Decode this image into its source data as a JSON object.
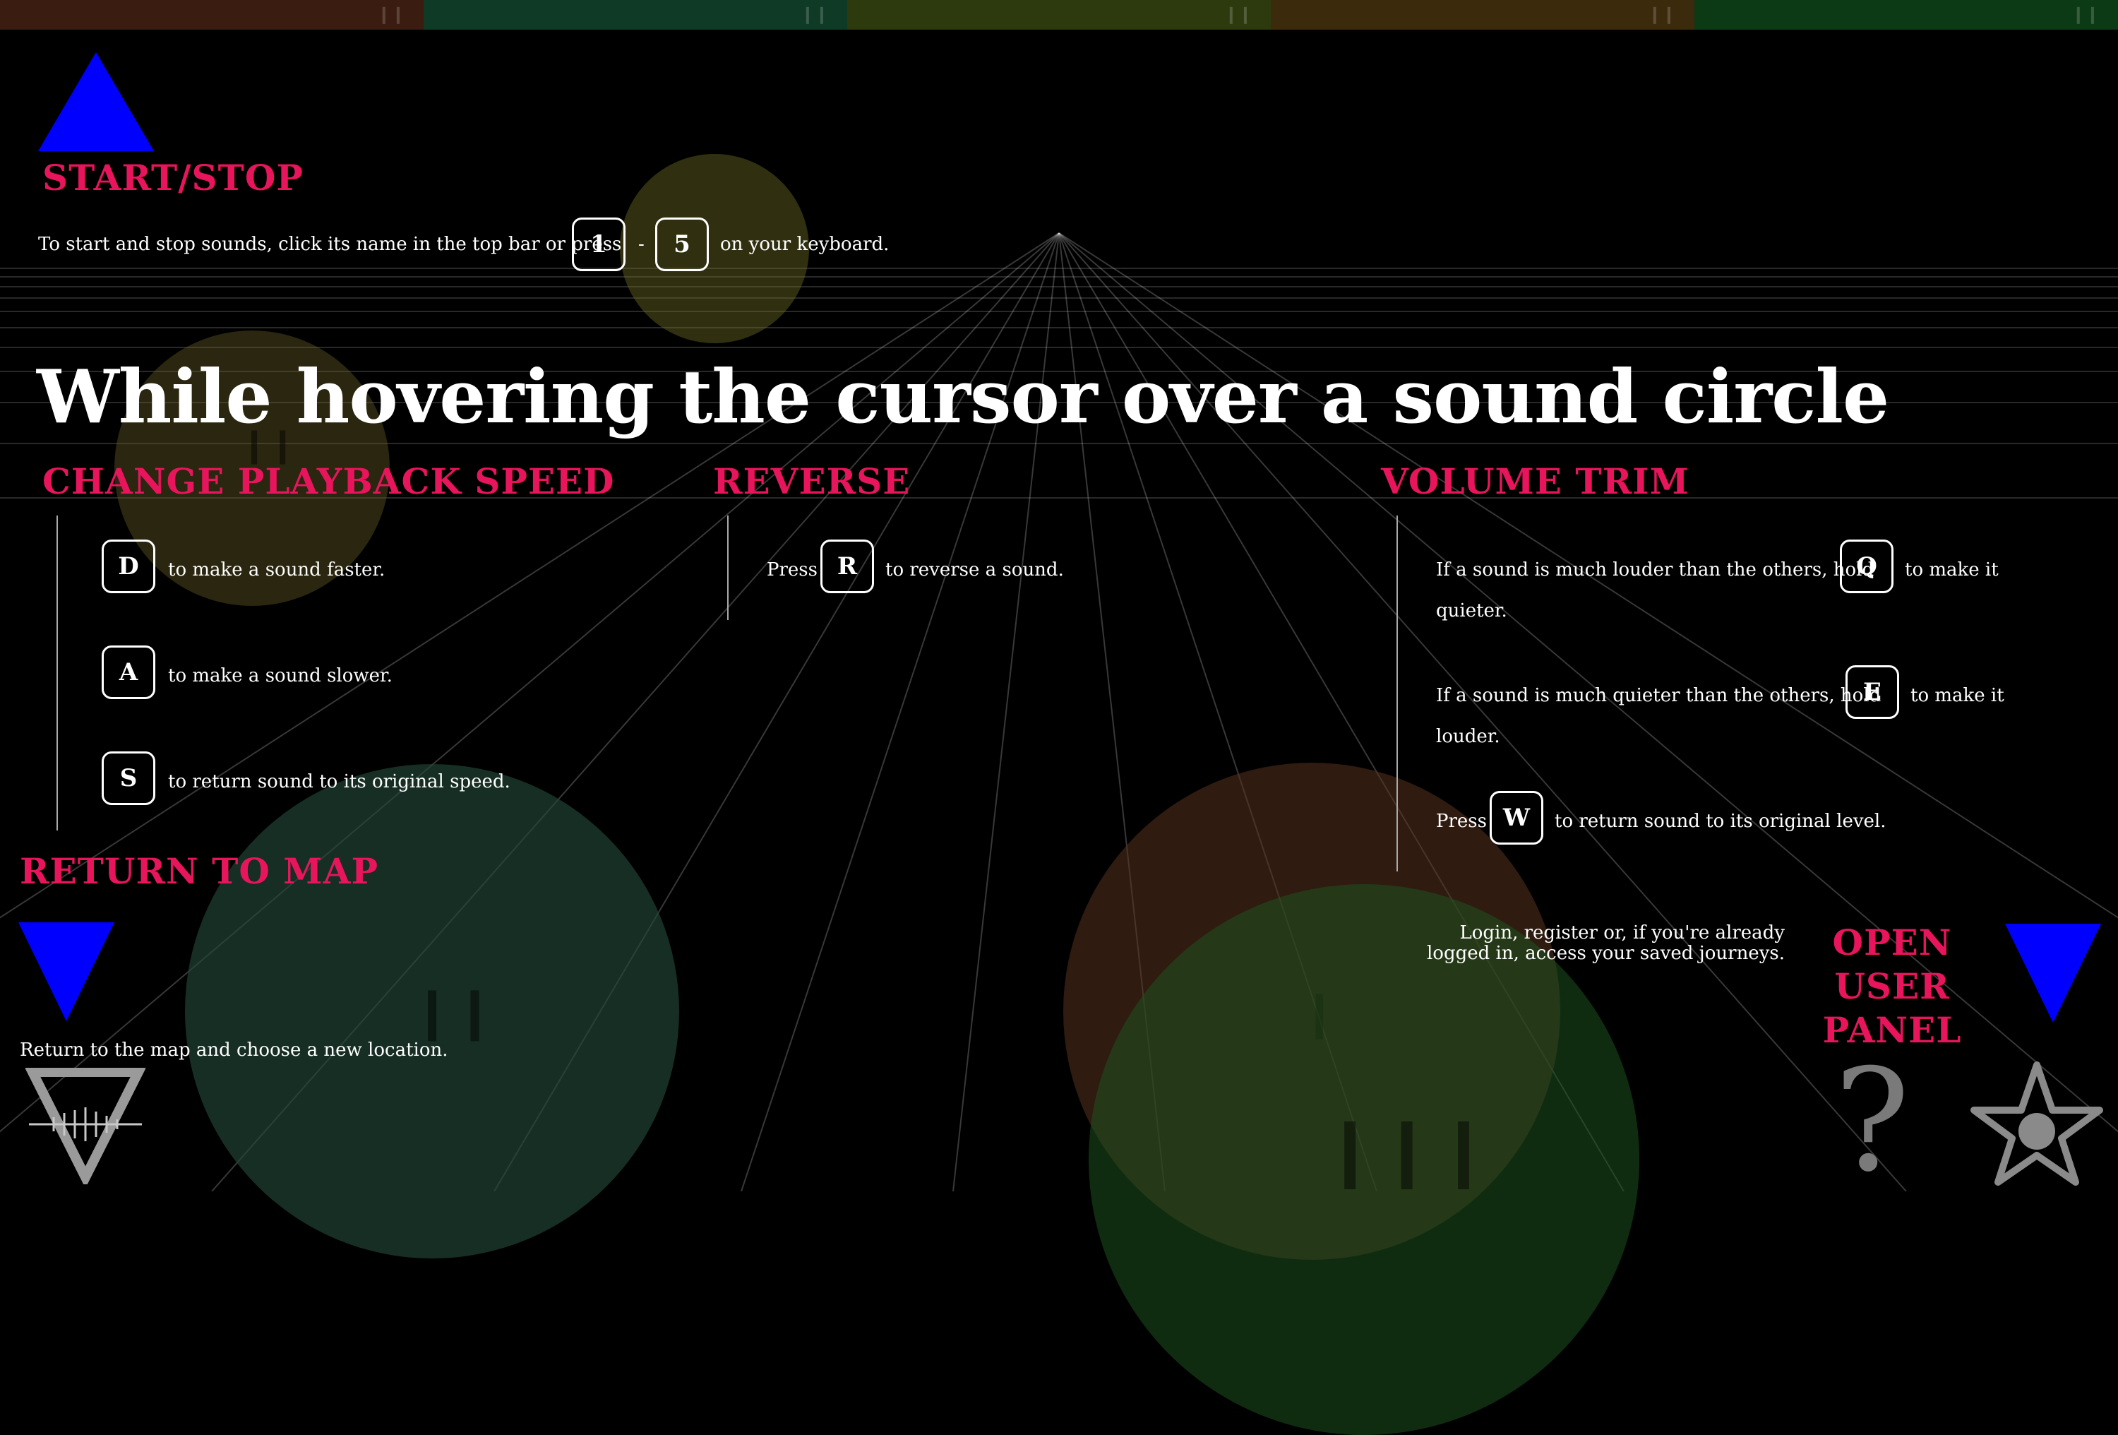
{
  "colors": {
    "accent": "#e8155d",
    "arrow": "#0000ff",
    "topbar": [
      "#3a1c10",
      "#0f3a26",
      "#2c3a0e",
      "#3b2a0c",
      "#0c3a14"
    ]
  },
  "start_stop": {
    "heading": "START/STOP",
    "text_before": "To start and stop sounds, click its name in the top bar or press",
    "key_from": "1",
    "separator": "-",
    "key_to": "5",
    "text_after": "on your keyboard."
  },
  "main_title": "While hovering the cursor over a sound circle",
  "speed": {
    "heading": "CHANGE PLAYBACK SPEED",
    "items": [
      {
        "key": "D",
        "text": "to make a sound faster."
      },
      {
        "key": "A",
        "text": "to make a sound slower."
      },
      {
        "key": "S",
        "text": "to return sound to its original speed."
      }
    ]
  },
  "reverse": {
    "heading": "REVERSE",
    "prefix": "Press",
    "key": "R",
    "text": "to reverse a sound."
  },
  "volume": {
    "heading": "VOLUME TRIM",
    "items": [
      {
        "before": "If a sound is much louder than the others, hold",
        "key": "Q",
        "after": "to make it",
        "line2": "quieter."
      },
      {
        "before": "If a sound is much quieter than the others, hold",
        "key": "E",
        "after": "to make it",
        "line2": "louder."
      },
      {
        "before": "Press",
        "key": "W",
        "after": "to return sound to its original level.",
        "line2": ""
      }
    ]
  },
  "return_map": {
    "heading": "RETURN TO MAP",
    "text": "Return to the map and choose a new location."
  },
  "user_panel": {
    "heading_lines": [
      "OPEN",
      "USER",
      "PANEL"
    ],
    "text_line1": "Login, register or, if you're already",
    "text_line2": "logged in, access your saved journeys."
  },
  "icons": {
    "logo": "triangle-waveform-logo-icon",
    "help": "question-mark-icon",
    "favorite": "star-icon",
    "pause": "pause-icon"
  }
}
